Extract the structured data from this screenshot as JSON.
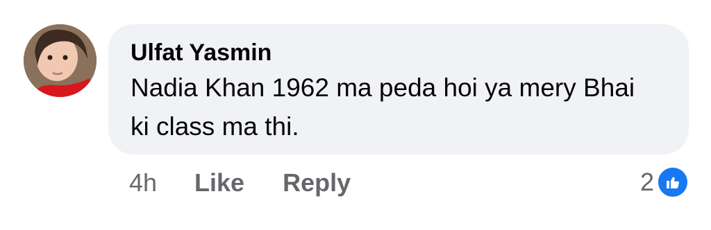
{
  "comment": {
    "author": "Ulfat Yasmin",
    "text": "Nadia Khan 1962 ma peda hoi ya mery Bhai ki class ma thi.",
    "timestamp": "4h",
    "like_label": "Like",
    "reply_label": "Reply",
    "reaction_count": "2",
    "reaction_icon": "thumbs-up-icon",
    "colors": {
      "bubble": "#f0f2f5",
      "like_badge": "#1877f2",
      "meta_text": "#65676b",
      "body_text": "#050505"
    }
  }
}
